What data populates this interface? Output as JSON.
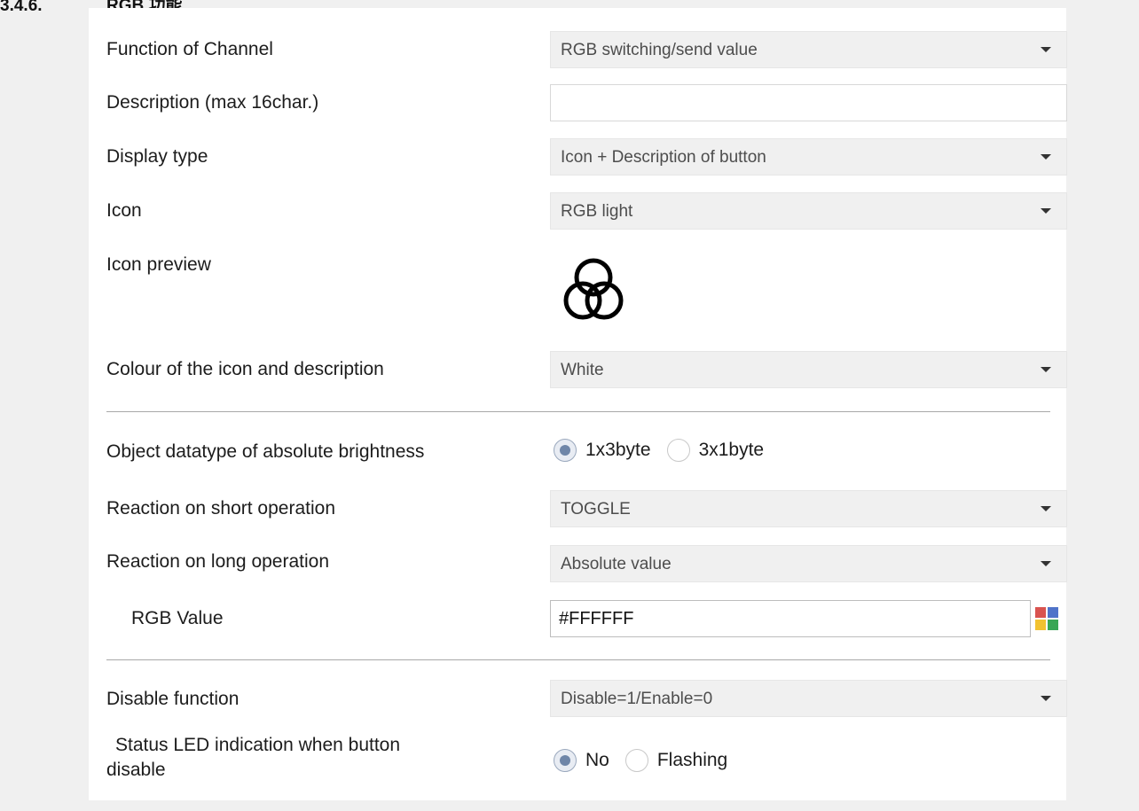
{
  "heading": {
    "number": "3.4.6.",
    "title": "RGB 功能"
  },
  "rows": {
    "function_of_channel": {
      "label": "Function of Channel",
      "value": "RGB switching/send value"
    },
    "description": {
      "label": "Description (max 16char.)",
      "value": ""
    },
    "display_type": {
      "label": "Display type",
      "value": "Icon + Description of button"
    },
    "icon": {
      "label": "Icon",
      "value": "RGB light"
    },
    "icon_preview": {
      "label": "Icon preview",
      "icon": "rgb-circles-icon"
    },
    "colour": {
      "label": "Colour of the icon and description",
      "value": "White"
    },
    "datatype": {
      "label": "Object datatype of absolute brightness",
      "options": [
        "1x3byte",
        "3x1byte"
      ],
      "selected": "1x3byte"
    },
    "short_op": {
      "label": "Reaction on short operation",
      "value": "TOGGLE"
    },
    "long_op": {
      "label": "Reaction on long operation",
      "value": "Absolute value"
    },
    "rgb_value": {
      "label": "RGB Value",
      "value": "#FFFFFF",
      "picker_colors": [
        "#d9534f",
        "#4f73c9",
        "#f2c230",
        "#3aa655"
      ]
    },
    "disable_function": {
      "label": "Disable function",
      "value": "Disable=1/Enable=0"
    },
    "status_led": {
      "label_line1": "Status LED indication when button",
      "label_line2": "disable",
      "options": [
        "No",
        "Flashing"
      ],
      "selected": "No"
    }
  }
}
